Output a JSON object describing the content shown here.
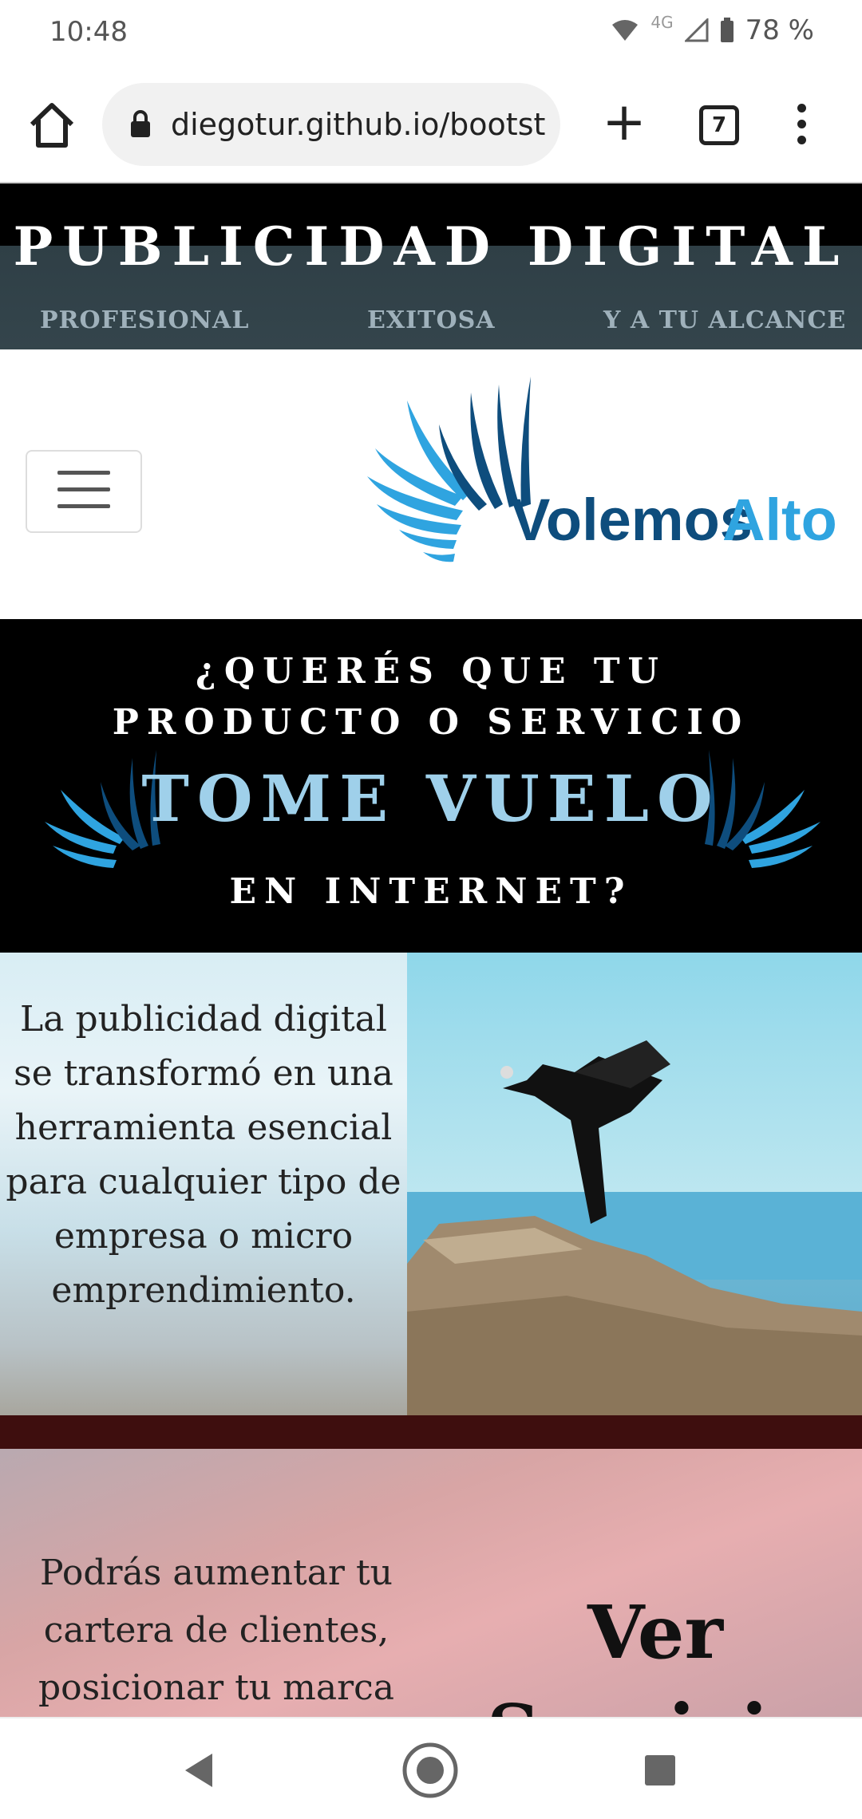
{
  "status": {
    "time": "10:48",
    "network": "4G",
    "battery": "78 %"
  },
  "browser": {
    "url": "diegotur.github.io/bootst",
    "tab_count": "7"
  },
  "hero": {
    "title": "PUBLICIDAD DIGITAL",
    "sub1": "PROFESIONAL",
    "sub2": "EXITOSA",
    "sub3": "Y A TU ALCANCE"
  },
  "logo": {
    "part1": "Volemos",
    "part2": "Alto"
  },
  "banner": {
    "line1": "¿QUERÉS QUE TU",
    "line2": "PRODUCTO O SERVICIO",
    "line3": "TOME VUELO",
    "line4": "EN INTERNET?"
  },
  "section1": {
    "text": "La publicidad digital se transformó en una herramienta esencial para cualquier tipo de empresa o micro emprendimiento."
  },
  "section2": {
    "text": "Podrás aumentar tu cartera de clientes, posicionar tu marca",
    "cta": "Ver",
    "cta2": "Servicios"
  },
  "colors": {
    "brand_blue": "#0e4d7d",
    "brand_light": "#2fa4e0",
    "divider": "#3e0e0e"
  }
}
